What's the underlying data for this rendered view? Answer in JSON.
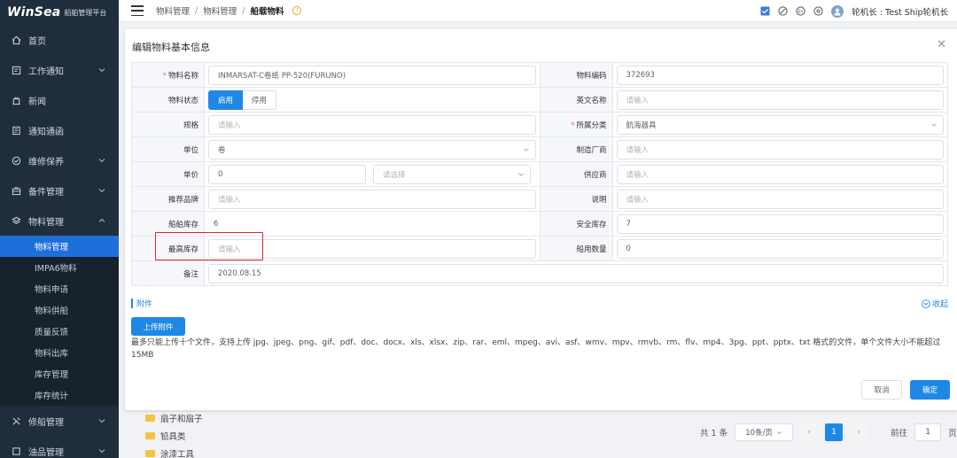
{
  "brand": {
    "name": "WinSea",
    "subtitle": "船舶管理平台"
  },
  "sidebar": {
    "items": [
      {
        "label": "首页",
        "icon": "home-icon"
      },
      {
        "label": "工作通知",
        "icon": "notice-icon",
        "arrow": "down"
      },
      {
        "label": "新闻",
        "icon": "news-icon"
      },
      {
        "label": "通知通函",
        "icon": "document-icon"
      },
      {
        "label": "维修保养",
        "icon": "check-circle-icon",
        "arrow": "down"
      },
      {
        "label": "备件管理",
        "icon": "briefcase-icon",
        "arrow": "down"
      },
      {
        "label": "物料管理",
        "icon": "layers-icon",
        "arrow": "up"
      }
    ],
    "sub_items": [
      "物料管理",
      "IMPA6物料",
      "物料申请",
      "物料供船",
      "质量反馈",
      "物料出库",
      "库存管理",
      "库存统计"
    ],
    "after_items": [
      {
        "label": "修船管理",
        "icon": "tools-icon",
        "arrow": "down"
      },
      {
        "label": "油品管理",
        "icon": "oil-icon",
        "arrow": "down"
      }
    ]
  },
  "header": {
    "breadcrumb": [
      "物料管理",
      "物料管理",
      "船载物料"
    ],
    "user": "轮机长 : Test Ship轮机长"
  },
  "dialog": {
    "title": "编辑物料基本信息",
    "fields": {
      "name_label": "物料名称",
      "name_value": "INMARSAT-C卷纸 PP-520(FURUNO)",
      "code_label": "物料编码",
      "code_value": "372693",
      "status_label": "物料状态",
      "status_on": "启用",
      "status_off": "停用",
      "en_label": "英文名称",
      "en_placeholder": "请输入",
      "spec_label": "规格",
      "spec_placeholder": "请输入",
      "category_label": "所属分类",
      "category_value": "航海器具",
      "unit_label": "单位",
      "unit_value": "卷",
      "maker_label": "制造厂商",
      "maker_placeholder": "请输入",
      "price_label": "单价",
      "price_value": "0",
      "currency_placeholder": "请选择",
      "supplier_label": "供应商",
      "supplier_placeholder": "请输入",
      "brand_label": "推荐品牌",
      "brand_placeholder": "请输入",
      "desc_label": "说明",
      "desc_placeholder": "请输入",
      "ship_stock_label": "船舶库存",
      "ship_stock_value": "6",
      "safe_stock_label": "安全库存",
      "safe_stock_value": "7",
      "max_stock_label": "最高库存",
      "max_stock_placeholder": "请输入",
      "ship_qty_label": "船用数量",
      "ship_qty_value": "0",
      "remark_label": "备注",
      "remark_value": "2020.08.15"
    },
    "attachment": {
      "title": "附件",
      "collapse": "收起",
      "upload": "上传附件",
      "hint": "最多只能上传十个文件，支持上传 jpg、jpeg、png、gif、pdf、doc、docx、xls、xlsx、zip、rar、eml、mpeg、avi、asf、wmv、mpv、rmvb、rm、flv、mp4、3pg、ppt、pptx、txt 格式的文件，单个文件大小不能超过15MB"
    },
    "cancel": "取消",
    "confirm": "确定"
  },
  "background": {
    "list": [
      "扇子和扇子",
      "铅具类",
      "涂漆工具"
    ],
    "pager": {
      "total": "共 1 条",
      "page_size": "10条/页",
      "current": "1",
      "goto_label": "前往",
      "goto_value": "1",
      "unit": "页"
    }
  }
}
